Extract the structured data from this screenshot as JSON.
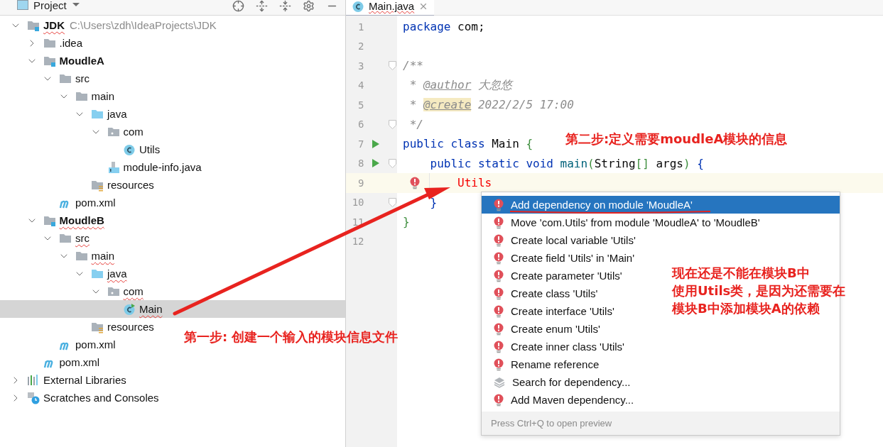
{
  "project_panel": {
    "title": "Project"
  },
  "tree": [
    {
      "label": "JDK",
      "path": "C:\\Users\\zdh\\IdeaProjects\\JDK",
      "kind": "module",
      "expanded": true,
      "selected": false,
      "error": true,
      "children": [
        {
          "label": ".idea",
          "kind": "folder",
          "expanded": false,
          "selected": false,
          "error": false
        },
        {
          "label": "MoudleA",
          "kind": "module",
          "expanded": true,
          "selected": false,
          "error": false,
          "children": [
            {
              "label": "src",
              "kind": "folder",
              "expanded": true,
              "selected": false,
              "error": false,
              "children": [
                {
                  "label": "main",
                  "kind": "folder",
                  "expanded": true,
                  "selected": false,
                  "error": false,
                  "children": [
                    {
                      "label": "java",
                      "kind": "source",
                      "expanded": true,
                      "selected": false,
                      "error": false,
                      "children": [
                        {
                          "label": "com",
                          "kind": "package",
                          "expanded": true,
                          "selected": false,
                          "error": false,
                          "children": [
                            {
                              "label": "Utils",
                              "kind": "class",
                              "selected": false,
                              "error": false
                            }
                          ]
                        },
                        {
                          "label": "module-info.java",
                          "kind": "module-info",
                          "selected": false,
                          "error": false
                        }
                      ]
                    },
                    {
                      "label": "resources",
                      "kind": "resources",
                      "selected": false,
                      "error": false
                    }
                  ]
                }
              ]
            },
            {
              "label": "pom.xml",
              "kind": "maven",
              "selected": false,
              "error": false
            }
          ]
        },
        {
          "label": "MoudleB",
          "kind": "module",
          "expanded": true,
          "selected": false,
          "error": true,
          "children": [
            {
              "label": "src",
              "kind": "folder",
              "expanded": true,
              "selected": false,
              "error": true,
              "children": [
                {
                  "label": "main",
                  "kind": "folder",
                  "expanded": true,
                  "selected": false,
                  "error": true,
                  "children": [
                    {
                      "label": "java",
                      "kind": "source",
                      "expanded": true,
                      "selected": false,
                      "error": true,
                      "children": [
                        {
                          "label": "com",
                          "kind": "package",
                          "expanded": true,
                          "selected": false,
                          "error": true,
                          "children": [
                            {
                              "label": "Main",
                              "kind": "main-class",
                              "selected": true,
                              "error": true
                            }
                          ]
                        }
                      ]
                    },
                    {
                      "label": "resources",
                      "kind": "resources",
                      "selected": false,
                      "error": false
                    }
                  ]
                }
              ]
            },
            {
              "label": "pom.xml",
              "kind": "maven",
              "selected": false,
              "error": false
            }
          ]
        },
        {
          "label": "pom.xml",
          "kind": "maven",
          "selected": false,
          "error": false
        }
      ]
    },
    {
      "label": "External Libraries",
      "kind": "libraries",
      "expanded": false,
      "selected": false,
      "error": false
    },
    {
      "label": "Scratches and Consoles",
      "kind": "scratches",
      "expanded": false,
      "selected": false,
      "error": false
    }
  ],
  "editor_tabs": [
    {
      "label": "Main.java",
      "selected": true,
      "error": true
    }
  ],
  "code_lines": [
    {
      "number": "1",
      "run": false,
      "fold": false,
      "highlighted": false,
      "bulb": false,
      "tokens": [
        {
          "text": "package",
          "kind": "keyword"
        },
        {
          "text": " com;",
          "kind": "plain"
        }
      ]
    },
    {
      "number": "2",
      "run": false,
      "fold": false,
      "highlighted": false,
      "bulb": false
    },
    {
      "number": "3",
      "run": false,
      "fold": true,
      "highlighted": false,
      "bulb": false,
      "tokens": [
        {
          "text": "/**",
          "kind": "comment"
        }
      ]
    },
    {
      "number": "4",
      "run": false,
      "fold": false,
      "highlighted": false,
      "bulb": false,
      "tokens": [
        {
          "text": " * ",
          "kind": "comment"
        },
        {
          "text": "@author",
          "kind": "doctag"
        },
        {
          "text": " 大忽悠",
          "kind": "comment"
        }
      ]
    },
    {
      "number": "5",
      "run": false,
      "fold": false,
      "highlighted": false,
      "bulb": false,
      "tokens": [
        {
          "text": " * ",
          "kind": "comment"
        },
        {
          "text": "@create",
          "kind": "doctag-marked"
        },
        {
          "text": " 2022/2/5 17:00",
          "kind": "comment"
        }
      ]
    },
    {
      "number": "6",
      "run": false,
      "fold": true,
      "highlighted": false,
      "bulb": false,
      "tokens": [
        {
          "text": " */",
          "kind": "comment"
        }
      ]
    },
    {
      "number": "7",
      "run": true,
      "fold": false,
      "highlighted": false,
      "bulb": false,
      "tokens": [
        {
          "text": "public class",
          "kind": "keyword"
        },
        {
          "text": " Main ",
          "kind": "plain"
        },
        {
          "text": "{",
          "kind": "bracket-green"
        }
      ]
    },
    {
      "number": "8",
      "run": true,
      "fold": true,
      "highlighted": false,
      "bulb": false,
      "tokens": [
        {
          "text": "    public static void ",
          "kind": "keyword"
        },
        {
          "text": "main",
          "kind": "method"
        },
        {
          "text": "(",
          "kind": "bracket-green"
        },
        {
          "text": "String",
          "kind": "plain"
        },
        {
          "text": "[]",
          "kind": "bracket-green"
        },
        {
          "text": " args",
          "kind": "plain"
        },
        {
          "text": ")",
          "kind": "bracket-green"
        },
        {
          "text": " {",
          "kind": "bracket-blue"
        }
      ]
    },
    {
      "number": "9",
      "run": false,
      "fold": false,
      "highlighted": true,
      "bulb": true,
      "tokens": [
        {
          "text": "        Utils",
          "kind": "error"
        }
      ]
    },
    {
      "number": "10",
      "run": false,
      "fold": true,
      "highlighted": false,
      "bulb": false,
      "tokens": [
        {
          "text": "    }",
          "kind": "bracket-blue"
        }
      ]
    },
    {
      "number": "11",
      "run": false,
      "fold": false,
      "highlighted": false,
      "bulb": false,
      "tokens": [
        {
          "text": "}",
          "kind": "bracket-green"
        }
      ]
    },
    {
      "number": "12",
      "run": false,
      "fold": false,
      "highlighted": false,
      "bulb": false
    }
  ],
  "popup": {
    "items": [
      {
        "label": "Add dependency on module 'MoudleA'",
        "kind": "fix",
        "selected": true
      },
      {
        "label": "Move 'com.Utils' from module 'MoudleA' to 'MoudleB'",
        "kind": "fix",
        "selected": false
      },
      {
        "label": "Create local variable 'Utils'",
        "kind": "fix",
        "selected": false
      },
      {
        "label": "Create field 'Utils' in 'Main'",
        "kind": "fix",
        "selected": false
      },
      {
        "label": "Create parameter 'Utils'",
        "kind": "fix",
        "selected": false
      },
      {
        "label": "Create class 'Utils'",
        "kind": "fix",
        "selected": false
      },
      {
        "label": "Create interface 'Utils'",
        "kind": "fix",
        "selected": false
      },
      {
        "label": "Create enum 'Utils'",
        "kind": "fix",
        "selected": false
      },
      {
        "label": "Create inner class 'Utils'",
        "kind": "fix",
        "selected": false
      },
      {
        "label": "Rename reference",
        "kind": "fix",
        "selected": false
      },
      {
        "label": "Search for dependency...",
        "kind": "library",
        "selected": false
      },
      {
        "label": "Add Maven dependency...",
        "kind": "fix",
        "selected": false
      }
    ],
    "footer": "Press Ctrl+Q to open preview"
  },
  "annotations": [
    {
      "lines": [
        "第一步: 创建一个输入的模块信息文件"
      ]
    },
    {
      "lines": [
        "第二步:定义需要moudleA模块的信息"
      ]
    },
    {
      "lines": [
        "现在还是不能在模块B中",
        "使用Utils类，是因为还需要在",
        "模块B中添加模块A的依赖"
      ]
    }
  ]
}
